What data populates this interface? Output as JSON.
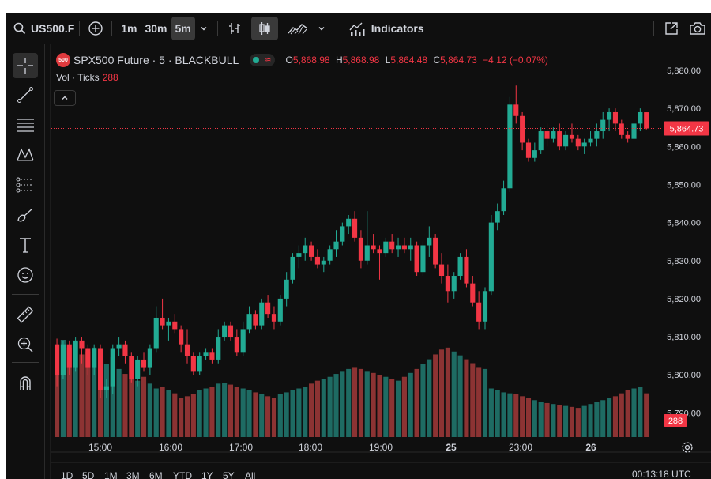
{
  "toolbar": {
    "symbol": "US500.F",
    "intervals": [
      "1m",
      "30m",
      "5m"
    ],
    "active_interval": "5m",
    "indicators_label": "Indicators"
  },
  "legend": {
    "badge": "500",
    "title": "SPX500 Future · 5 · BLACKBULL",
    "ohlc": {
      "o_key": "O",
      "o": "5,868.98",
      "h_key": "H",
      "h": "5,868.98",
      "l_key": "L",
      "l": "5,864.48",
      "c_key": "C",
      "c": "5,864.73",
      "change": "−4.12 (−0.07%)"
    },
    "vol_label": "Vol · Ticks",
    "vol_value": "288"
  },
  "price_axis": {
    "labels": [
      "5,880.00",
      "5,870.00",
      "5,860.00",
      "5,850.00",
      "5,840.00",
      "5,830.00",
      "5,820.00",
      "5,810.00",
      "5,800.00",
      "5,790.00"
    ],
    "current_price": "5,864.73",
    "volume_badge": "288"
  },
  "time_axis": {
    "labels": [
      "15:00",
      "16:00",
      "17:00",
      "18:00",
      "19:00",
      "25",
      "23:00",
      "26"
    ]
  },
  "ranges": [
    "1D",
    "5D",
    "1M",
    "3M",
    "6M",
    "YTD",
    "1Y",
    "5Y",
    "All"
  ],
  "clock": "00:13:18 UTC",
  "colors": {
    "up": "#22ab94",
    "down": "#f23645",
    "vol_up": "#1e6b63",
    "vol_down": "#8c3333"
  },
  "chart_data": {
    "type": "candlestick",
    "ylim": [
      5786,
      5884
    ],
    "candles": [
      [
        5808,
        5809.5,
        5797,
        5800
      ],
      [
        5800,
        5809,
        5799,
        5808
      ],
      [
        5808,
        5809,
        5800,
        5802
      ],
      [
        5802,
        5810,
        5801,
        5809
      ],
      [
        5809,
        5810,
        5803,
        5807
      ],
      [
        5807,
        5808,
        5800,
        5802
      ],
      [
        5802,
        5808,
        5800,
        5807
      ],
      [
        5807,
        5808,
        5794,
        5796
      ],
      [
        5796,
        5799,
        5794,
        5797
      ],
      [
        5797,
        5808,
        5795,
        5807
      ],
      [
        5807,
        5810,
        5805,
        5808
      ],
      [
        5808,
        5809,
        5803,
        5805
      ],
      [
        5805,
        5806,
        5798,
        5799
      ],
      [
        5799,
        5805,
        5797,
        5804
      ],
      [
        5804,
        5806,
        5801,
        5802
      ],
      [
        5802,
        5808,
        5800,
        5807
      ],
      [
        5807,
        5818,
        5806,
        5815
      ],
      [
        5815,
        5820,
        5812,
        5813
      ],
      [
        5813,
        5815,
        5809,
        5814
      ],
      [
        5814,
        5816,
        5811,
        5812
      ],
      [
        5812,
        5813,
        5806,
        5808
      ],
      [
        5808,
        5812,
        5803,
        5805
      ],
      [
        5805,
        5806,
        5800,
        5801
      ],
      [
        5801,
        5806,
        5800,
        5805
      ],
      [
        5805,
        5807,
        5804,
        5806
      ],
      [
        5806,
        5807,
        5803,
        5804
      ],
      [
        5804,
        5812,
        5803,
        5810
      ],
      [
        5810,
        5814,
        5809,
        5813
      ],
      [
        5813,
        5814,
        5809,
        5810
      ],
      [
        5810,
        5812,
        5805,
        5806
      ],
      [
        5806,
        5814,
        5805,
        5812
      ],
      [
        5812,
        5818,
        5811,
        5816
      ],
      [
        5816,
        5817,
        5812,
        5813
      ],
      [
        5813,
        5820,
        5812,
        5819
      ],
      [
        5819,
        5821,
        5815,
        5816
      ],
      [
        5816,
        5818,
        5812,
        5814
      ],
      [
        5814,
        5821,
        5813,
        5820
      ],
      [
        5820,
        5827,
        5818,
        5825
      ],
      [
        5825,
        5832,
        5824,
        5831
      ],
      [
        5831,
        5834,
        5828,
        5832
      ],
      [
        5832,
        5836,
        5830,
        5834
      ],
      [
        5834,
        5835,
        5830,
        5831
      ],
      [
        5831,
        5833,
        5828,
        5829
      ],
      [
        5829,
        5831,
        5827,
        5830
      ],
      [
        5830,
        5834,
        5829,
        5833
      ],
      [
        5833,
        5838,
        5831,
        5835
      ],
      [
        5835,
        5840,
        5834,
        5839
      ],
      [
        5839,
        5842,
        5837,
        5841
      ],
      [
        5841,
        5843,
        5835,
        5836
      ],
      [
        5836,
        5838,
        5828,
        5830
      ],
      [
        5830,
        5843,
        5829,
        5834
      ],
      [
        5834,
        5837,
        5832,
        5833
      ],
      [
        5833,
        5834,
        5825,
        5832
      ],
      [
        5832,
        5836,
        5831,
        5835
      ],
      [
        5835,
        5837,
        5832,
        5833
      ],
      [
        5833,
        5836,
        5831,
        5834
      ],
      [
        5834,
        5836,
        5832,
        5833
      ],
      [
        5833,
        5836,
        5830,
        5834
      ],
      [
        5834,
        5835,
        5826,
        5827
      ],
      [
        5827,
        5835,
        5826,
        5834
      ],
      [
        5834,
        5839,
        5831,
        5836
      ],
      [
        5836,
        5837,
        5828,
        5829
      ],
      [
        5829,
        5832,
        5824,
        5826
      ],
      [
        5826,
        5829,
        5819,
        5822
      ],
      [
        5822,
        5827,
        5820,
        5826
      ],
      [
        5826,
        5832,
        5825,
        5831
      ],
      [
        5831,
        5833,
        5823,
        5824
      ],
      [
        5824,
        5826,
        5818,
        5819
      ],
      [
        5819,
        5822,
        5812,
        5814
      ],
      [
        5814,
        5823,
        5812,
        5822
      ],
      [
        5822,
        5842,
        5821,
        5840
      ],
      [
        5840,
        5845,
        5838,
        5843
      ],
      [
        5843,
        5851,
        5842,
        5849
      ],
      [
        5849,
        5873,
        5848,
        5871
      ],
      [
        5871,
        5876,
        5866,
        5868
      ],
      [
        5868,
        5869,
        5859,
        5861
      ],
      [
        5861,
        5862,
        5856,
        5857
      ],
      [
        5857,
        5861,
        5856,
        5859
      ],
      [
        5859,
        5865,
        5858,
        5864
      ],
      [
        5864,
        5866,
        5860,
        5862
      ],
      [
        5862,
        5865,
        5861,
        5864
      ],
      [
        5864,
        5866,
        5859,
        5860
      ],
      [
        5860,
        5864,
        5859,
        5863
      ],
      [
        5863,
        5866,
        5861,
        5862
      ],
      [
        5862,
        5863,
        5859,
        5860
      ],
      [
        5860,
        5862,
        5858,
        5861
      ],
      [
        5861,
        5864,
        5860,
        5862
      ],
      [
        5862,
        5866,
        5860,
        5864
      ],
      [
        5864,
        5869,
        5862,
        5867
      ],
      [
        5867,
        5870,
        5864,
        5869
      ],
      [
        5869,
        5870,
        5864,
        5866
      ],
      [
        5866,
        5867,
        5862,
        5863
      ],
      [
        5863,
        5864,
        5861,
        5862
      ],
      [
        5862,
        5868,
        5861,
        5866
      ],
      [
        5866,
        5870,
        5864,
        5869
      ],
      [
        5868.98,
        5868.98,
        5864.48,
        5864.73
      ]
    ],
    "volume": [
      95,
      100,
      92,
      98,
      85,
      88,
      92,
      80,
      75,
      82,
      70,
      65,
      60,
      58,
      62,
      55,
      50,
      52,
      48,
      45,
      40,
      42,
      44,
      48,
      50,
      52,
      55,
      56,
      54,
      52,
      50,
      48,
      46,
      44,
      42,
      40,
      44,
      46,
      48,
      50,
      52,
      55,
      58,
      60,
      62,
      65,
      68,
      70,
      72,
      70,
      68,
      66,
      64,
      62,
      60,
      58,
      62,
      66,
      70,
      75,
      80,
      85,
      90,
      92,
      88,
      84,
      80,
      76,
      72,
      70,
      50,
      48,
      46,
      45,
      44,
      42,
      40,
      38,
      36,
      35,
      34,
      33,
      32,
      31,
      30,
      32,
      34,
      36,
      38,
      40,
      42,
      45,
      48,
      50,
      52,
      45
    ]
  }
}
